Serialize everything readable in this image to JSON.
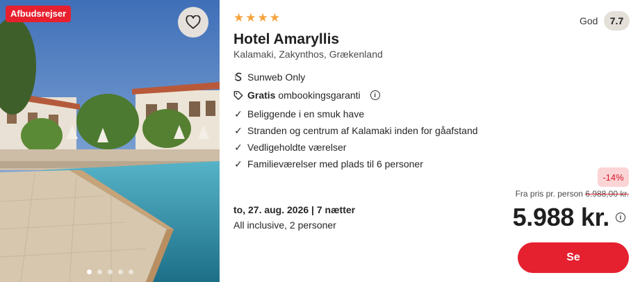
{
  "badge": "Afbudsrejser",
  "icons": {
    "favorite": "heart-icon",
    "star": "star-icon",
    "sunweb": "sunweb-logo-icon",
    "tag": "tag-icon",
    "info": "info-icon",
    "check": "check-icon"
  },
  "gallery": {
    "slides": 5,
    "active_index": 0
  },
  "hotel": {
    "stars": 4,
    "star_glyph": "★",
    "name": "Hotel Amaryllis",
    "location": "Kalamaki, Zakynthos, Grækenland"
  },
  "rating": {
    "label": "God",
    "score": "7.7"
  },
  "features": {
    "sunweb": "Sunweb Only",
    "guarantee_bold": "Gratis",
    "guarantee_rest": "ombookingsgaranti",
    "info_glyph": "i",
    "check_glyph": "✓",
    "bullets": [
      "Beliggende i en smuk have",
      "Stranden og centrum af Kalamaki inden for gåafstand",
      "Vedligeholdte værelser",
      "Familieværelser med plads til 6 personer"
    ]
  },
  "trip": {
    "date": "to, 27. aug. 2026 | 7 nætter",
    "board": "All inclusive, 2 personer"
  },
  "pricing": {
    "discount": "-14%",
    "from_label": "Fra pris pr. person",
    "old_price": "6.988,00 kr.",
    "price": "5.988 kr.",
    "info_glyph": "i"
  },
  "cta": {
    "label": "Se"
  },
  "colors": {
    "brand_red": "#e5202f",
    "star_orange": "#f7a23b",
    "discount_bg": "#fbd4d6",
    "rating_bg": "#e4dfd8"
  }
}
